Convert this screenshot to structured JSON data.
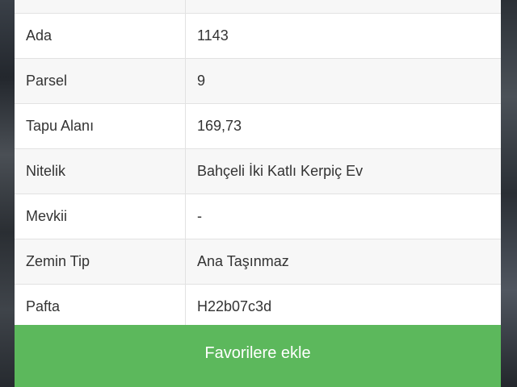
{
  "parcel_table": {
    "rows": [
      {
        "label": "Ada",
        "value": "1143"
      },
      {
        "label": "Parsel",
        "value": "9"
      },
      {
        "label": "Tapu Alanı",
        "value": "169,73"
      },
      {
        "label": "Nitelik",
        "value": "Bahçeli İki Katlı Kerpiç Ev"
      },
      {
        "label": "Mevkii",
        "value": "-"
      },
      {
        "label": "Zemin Tip",
        "value": "Ana Taşınmaz"
      },
      {
        "label": "Pafta",
        "value": "H22b07c3d"
      }
    ]
  },
  "actions": {
    "add_to_favorites_label": "Favorilere ekle"
  },
  "colors": {
    "button_green": "#5cb85c",
    "row_stripe": "#f7f7f7",
    "text": "#333333"
  }
}
